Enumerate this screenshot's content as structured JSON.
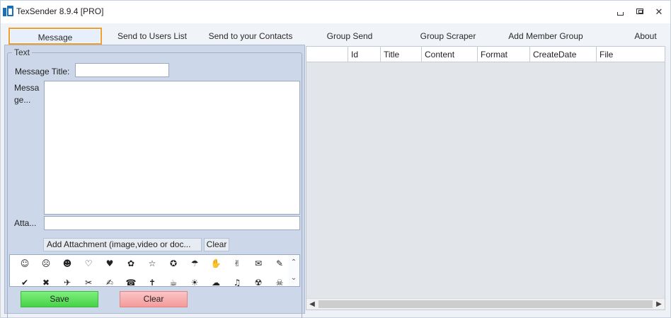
{
  "window": {
    "title": "TexSender 8.9.4 [PRO]",
    "controls": {
      "minimize_icon": "minimize-icon",
      "maximize_icon": "restore-icon",
      "close_icon": "close-icon",
      "close_glyph": "✕"
    }
  },
  "tabs": [
    {
      "label": "Message",
      "active": true
    },
    {
      "label": "Send to Users List"
    },
    {
      "label": "Send to your Contacts"
    },
    {
      "label": "Group Send"
    },
    {
      "label": "Group Scraper"
    },
    {
      "label": "Add Member Group"
    },
    {
      "label": "About"
    }
  ],
  "form": {
    "group_title": "Text",
    "message_title_label": "Message Title:",
    "message_title_value": "",
    "message_label_line1": "Messa",
    "message_label_line2": "ge...",
    "message_value": "",
    "attachment_label": "Atta...",
    "attachment_value": "",
    "add_attachment_button": "Add  Attachment  (image,video  or doc...",
    "clear_attachment_button": "Clear"
  },
  "emoji": {
    "row1": [
      "☺",
      "☹",
      "☻",
      "♡",
      "♥",
      "✿",
      "☆",
      "✪",
      "☂",
      "✋",
      "✌",
      "✉",
      "✎"
    ],
    "row2": [
      "✔",
      "✖",
      "✈",
      "✂",
      "✍",
      "☎",
      "✝",
      "☕",
      "☀",
      "☁",
      "♫",
      "☢",
      "☠"
    ],
    "scroll_up": "⌃",
    "scroll_down": "⌄"
  },
  "actions": {
    "save_label": "Save",
    "clear_label": "Clear",
    "save_color": "#5ee35e",
    "clear_color": "#f6adad"
  },
  "grid": {
    "columns": [
      "",
      "Id",
      "Title",
      "Content",
      "Format",
      "CreateDate",
      "File"
    ],
    "rows": []
  }
}
